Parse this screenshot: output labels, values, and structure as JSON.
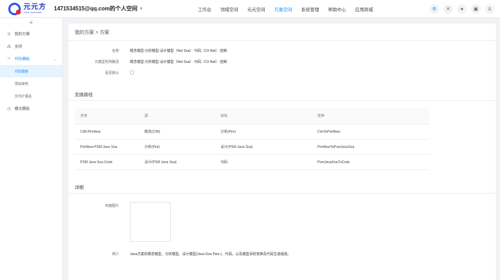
{
  "header": {
    "brand_name": "元元方",
    "brand_sub": "YUAN YUAN FANG",
    "account": "1471534515@qq.com的个人空间",
    "nav": [
      "工作台",
      "领域空间",
      "元元空间",
      "方案空间",
      "系统管理",
      "帮助中心",
      "应用商城"
    ],
    "active_nav": "方案空间",
    "icons": [
      "settings-icon",
      "close-icon",
      "bell-icon",
      "document-icon",
      "user-icon"
    ]
  },
  "sidebar": {
    "collapse_icon": "menu-icon",
    "items": [
      {
        "label": "我的方案",
        "icon": "location-icon"
      },
      {
        "label": "支持",
        "icon": "nodes-icon"
      },
      {
        "label": "代码模板",
        "icon": "code-icon",
        "open": true
      }
    ],
    "sub_items": [
      {
        "label": "代码模板",
        "active": true
      },
      {
        "label": "项目架构"
      },
      {
        "label": "文件扩展名"
      }
    ],
    "after_items": [
      {
        "label": "模式模板",
        "icon": "clock-icon"
      }
    ]
  },
  "main": {
    "breadcrumb": "我的方案 > 方案",
    "fields": {
      "name_label": "名称",
      "name_value": "概念模型-分析模型-设计模型（Net Soa）-代码（C#.Net）-控制",
      "origin_label": "元模型实例路径",
      "origin_value": "概念模型-分析模型-设计模型（Net Soa）-代码（C#.Net）-控制",
      "default_label": "是否默认",
      "default_checked": false
    },
    "transform_title": "变换路线",
    "table": {
      "headers": [
        "支持",
        "源",
        "目标",
        "变换"
      ],
      "rows": [
        [
          "CIM-PimNew",
          "概念(CIM)",
          "分析(Pim)",
          "CimToPimNew"
        ],
        [
          "PimNew-PSM Java Soa",
          "分析(Pim)",
          "设计(PSM Java Soa)",
          "PimNewToPsmJavaSoa"
        ],
        [
          "PSM Java Soa-Code",
          "设计(PSM Java Soa)",
          "代码",
          "PsmJavaSoaToCode"
        ]
      ]
    },
    "detail_title": "详细",
    "detail": {
      "image_label": "封面图片",
      "intro_label": "简介",
      "intro_value": "Java方案的概念模型、分析模型、设计模型(Java Soa Psm )、代码，以及模型间的变换及代码生成组成。"
    }
  },
  "colors": {
    "accent": "#1890ff",
    "brand": "#1d39c4",
    "background": "#f0f2f5"
  }
}
